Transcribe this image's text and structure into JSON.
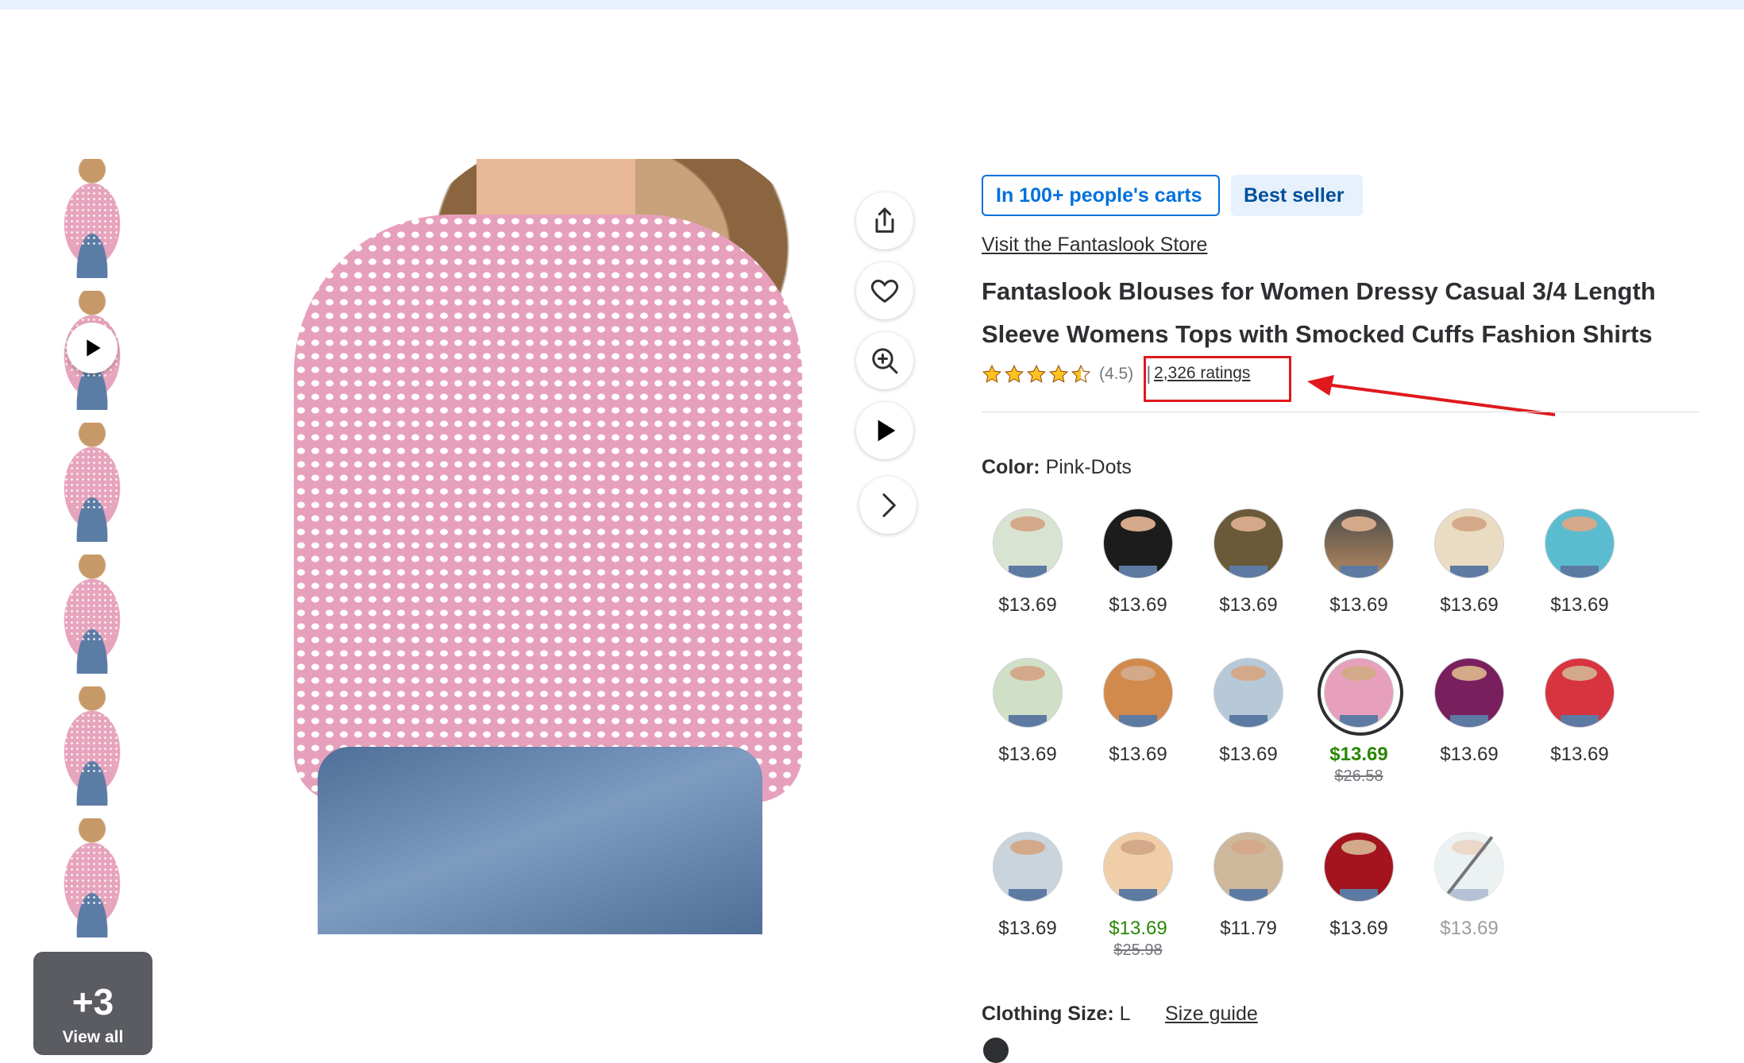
{
  "thumbnails": [
    {
      "alt": "thumbnail 1"
    },
    {
      "alt": "thumbnail 2 video",
      "has_play": true
    },
    {
      "alt": "thumbnail 3"
    },
    {
      "alt": "thumbnail 4"
    },
    {
      "alt": "thumbnail 5"
    },
    {
      "alt": "thumbnail 6"
    }
  ],
  "view_all": {
    "count": "+3",
    "label": "View all"
  },
  "image_actions": [
    "share-icon",
    "heart-icon",
    "zoom-in-icon",
    "play-icon",
    "chevron-right-icon"
  ],
  "badges": {
    "carts": "In 100+ people's carts",
    "best_seller": "Best seller"
  },
  "store_link": "Visit the Fantaslook Store",
  "title": "Fantaslook Blouses for Women Dressy Casual 3/4 Length Sleeve Womens Tops with Smocked Cuffs Fashion Shirts",
  "rating": {
    "stars": 4.5,
    "value_text": "(4.5)",
    "separator": "|",
    "ratings_link": "2,326 ratings"
  },
  "colors_accent": {
    "brand_blue": "#0071dc",
    "sale_green": "#2a8703",
    "highlight_red": "#e0181e"
  },
  "color_selector": {
    "label": "Color:",
    "selected": "Pink-Dots",
    "swatches": [
      {
        "price": "$13.69"
      },
      {
        "price": "$13.69"
      },
      {
        "price": "$13.69"
      },
      {
        "price": "$13.69"
      },
      {
        "price": "$13.69"
      },
      {
        "price": "$13.69"
      },
      {
        "price": "$13.69"
      },
      {
        "price": "$13.69"
      },
      {
        "price": "$13.69"
      },
      {
        "price": "$13.69",
        "was": "$26.58",
        "selected": true
      },
      {
        "price": "$13.69"
      },
      {
        "price": "$13.69"
      },
      {
        "price": "$13.69"
      },
      {
        "price": "$13.69",
        "was": "$25.98"
      },
      {
        "price": "$11.79"
      },
      {
        "price": "$13.69"
      },
      {
        "price": "$13.69",
        "unavailable": true
      }
    ]
  },
  "size": {
    "label": "Clothing Size:",
    "value": "L",
    "guide_link": "Size guide"
  }
}
